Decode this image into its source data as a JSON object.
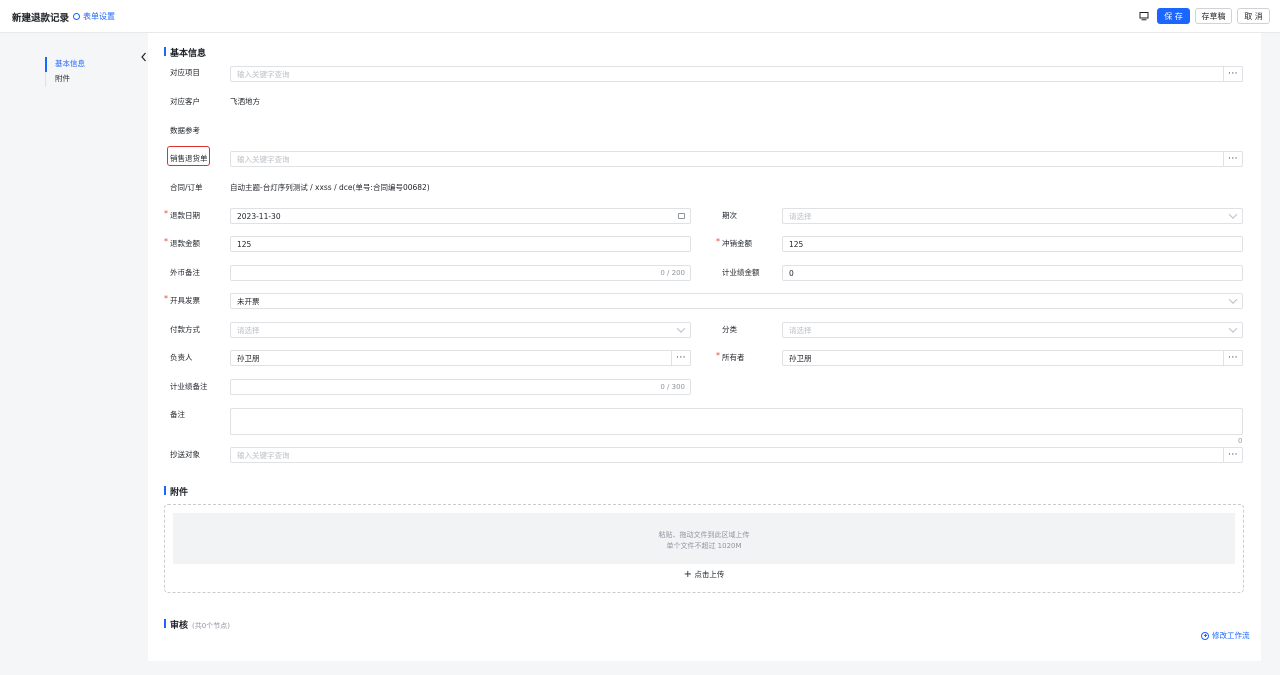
{
  "header": {
    "title": "新建退款记录",
    "form_settings": "表单设置",
    "save": "保 存",
    "draft": "存草稿",
    "cancel": "取 消"
  },
  "nav": {
    "items": [
      "基本信息",
      "附件"
    ]
  },
  "sections": {
    "basic": "基本信息",
    "attach": "附件",
    "review": "审核",
    "review_sub": "(共0个节点)"
  },
  "fields": {
    "project": {
      "label": "对应项目",
      "placeholder": "输入关键字查询"
    },
    "customer": {
      "label": "对应客户",
      "value": "飞洒地方"
    },
    "data_ref": {
      "label": "数据参考"
    },
    "sales_return": {
      "label": "销售退货单",
      "placeholder": "输入关键字查询"
    },
    "contract": {
      "label": "合同/订单",
      "value": "自动主题-台灯序列测试 / xxss / dce(单号:合同编号00682)"
    },
    "refund_date": {
      "label": "退款日期",
      "value": "2023-11-30"
    },
    "period": {
      "label": "期次",
      "placeholder": "请选择"
    },
    "refund_amount": {
      "label": "退款金额",
      "value": "125"
    },
    "offset_amount": {
      "label": "冲销金额",
      "value": "125"
    },
    "fx_note": {
      "label": "外币备注",
      "counter": "0 / 200"
    },
    "perf_amount": {
      "label": "计业绩金额",
      "value": "0"
    },
    "invoice": {
      "label": "开具发票",
      "value": "未开票"
    },
    "pay_method": {
      "label": "付款方式",
      "placeholder": "请选择"
    },
    "category": {
      "label": "分类",
      "placeholder": "请选择"
    },
    "owner": {
      "label": "负责人",
      "value": "孙卫朋"
    },
    "possessor": {
      "label": "所有者",
      "value": "孙卫朋"
    },
    "perf_note": {
      "label": "计业绩备注",
      "counter": "0 / 300"
    },
    "remark": {
      "label": "备注",
      "counter": "0"
    },
    "cc": {
      "label": "抄送对象",
      "placeholder": "输入关键字查询"
    }
  },
  "upload": {
    "line1": "粘贴、拖动文件到此区域上传",
    "line2": "单个文件不超过 1020M",
    "button": "点击上传"
  },
  "workflow": {
    "modify": "修改工作流"
  },
  "colors": {
    "primary": "#1a66ff",
    "required": "#e5493a",
    "highlight": "#e0322b"
  }
}
